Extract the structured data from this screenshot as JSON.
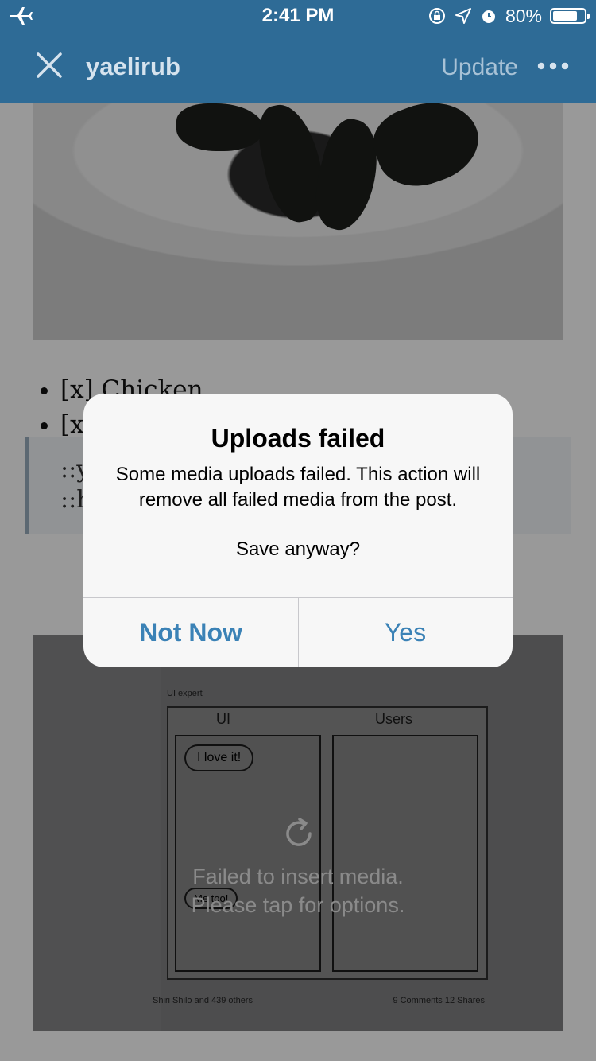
{
  "status_bar": {
    "time": "2:41 PM",
    "battery_percent": "80%",
    "battery_level": 0.8,
    "icons": [
      "airplane-icon",
      "rotation-lock-icon",
      "location-icon",
      "alarm-icon",
      "battery-icon"
    ]
  },
  "nav": {
    "title": "yaelirub",
    "update_label": "Update",
    "close_icon": "close-icon",
    "more_icon": "more-icon"
  },
  "editor": {
    "checklist": [
      "[x] Chicken",
      "[x"
    ],
    "quote_lines": [
      "::y",
      "::h"
    ],
    "media_error_line1": "Failed to insert media.",
    "media_error_line2": "Please tap for options.",
    "media_retry_icon": "retry-icon",
    "embedded_image_text": {
      "ui_label": "UI",
      "users_label": "Users",
      "ui_expert": "UI expert",
      "love_it": "I love it!",
      "me_too": "Me too!",
      "reactions": "Shiri Shilo and 439 others",
      "comments_shares": "9 Comments  12 Shares"
    }
  },
  "alert": {
    "title": "Uploads failed",
    "message": "Some media uploads failed. This action will remove all failed media from the post.",
    "question": "Save anyway?",
    "not_now_label": "Not Now",
    "yes_label": "Yes"
  },
  "colors": {
    "nav_bg": "#2e6b96",
    "alert_button": "#3b82b6"
  }
}
